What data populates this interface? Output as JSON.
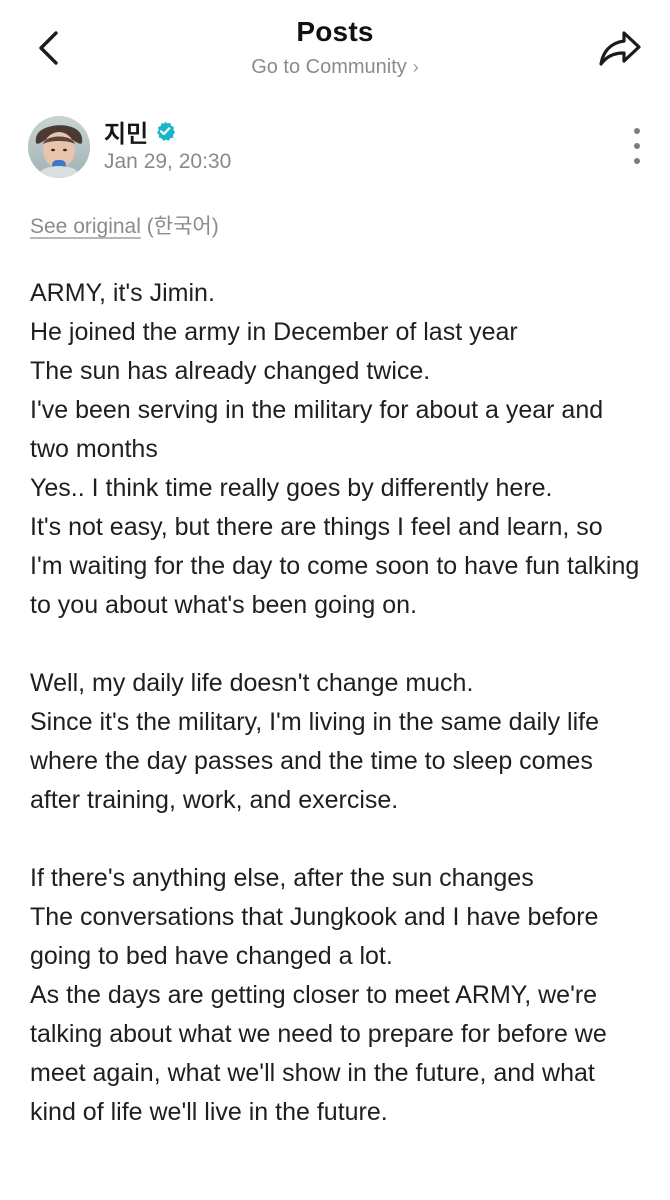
{
  "header": {
    "title": "Posts",
    "subtitle": "Go to Community",
    "subtitle_chevron": "›",
    "back_icon": "chevron-left-icon",
    "share_icon": "share-arrow-icon"
  },
  "author": {
    "name": "지민",
    "verified": true,
    "date": "Jan 29, 20:30",
    "verified_color": "#19b6c9"
  },
  "translation": {
    "see_original": "See original",
    "language": "(한국어)"
  },
  "post": {
    "paragraphs": [
      [
        "ARMY, it's Jimin.",
        "He joined the army in December of last year",
        "The sun has already changed twice.",
        "I've been serving in the military for about a year and two months",
        "Yes.. I think time really goes by differently here.",
        "It's not easy, but there are things I feel and learn, so I'm waiting for the day to come soon to have fun talking to you about what's been going on."
      ],
      [
        "Well, my daily life doesn't change much.",
        "Since it's the military, I'm living in the same daily life where the day passes and the time to sleep comes after training, work, and exercise."
      ],
      [
        "If there's anything else, after the sun changes",
        "The conversations that Jungkook and I have before going to bed have changed a lot.",
        "As the days are getting closer to meet ARMY, we're talking about what we need to prepare for before we meet again, what we'll show in the future, and what kind of life we'll live in the future."
      ]
    ]
  }
}
